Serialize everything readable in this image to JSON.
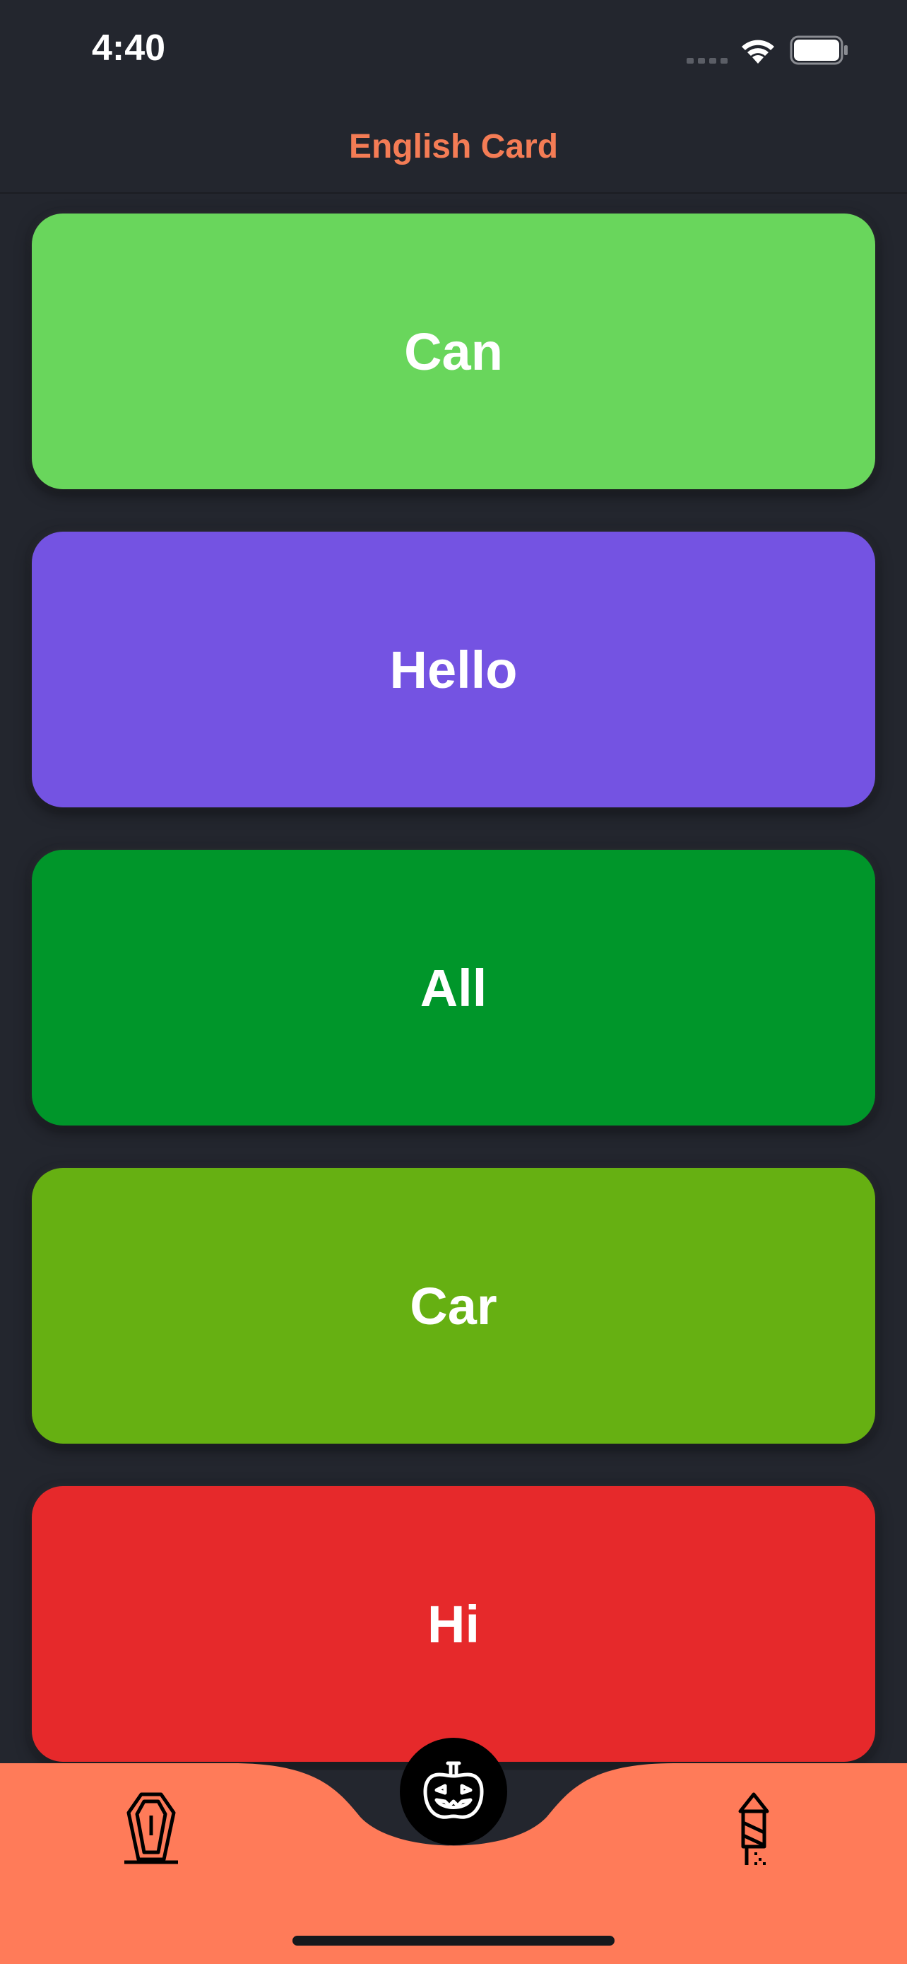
{
  "status_bar": {
    "time": "4:40"
  },
  "nav": {
    "title": "English Card"
  },
  "cards": [
    {
      "label": "Can",
      "color": "#69d65c"
    },
    {
      "label": "Hello",
      "color": "#7453e2"
    },
    {
      "label": "All",
      "color": "#00962a"
    },
    {
      "label": "Car",
      "color": "#66b012"
    },
    {
      "label": "Hi",
      "color": "#e6292b"
    }
  ],
  "tab_bar": {
    "background": "#ff7b59",
    "items": [
      {
        "icon": "coffin-icon"
      },
      {
        "icon": "pumpkin-icon",
        "active": true
      },
      {
        "icon": "firework-rocket-icon"
      }
    ]
  },
  "colors": {
    "background": "#23262e",
    "accent": "#f47c55"
  }
}
